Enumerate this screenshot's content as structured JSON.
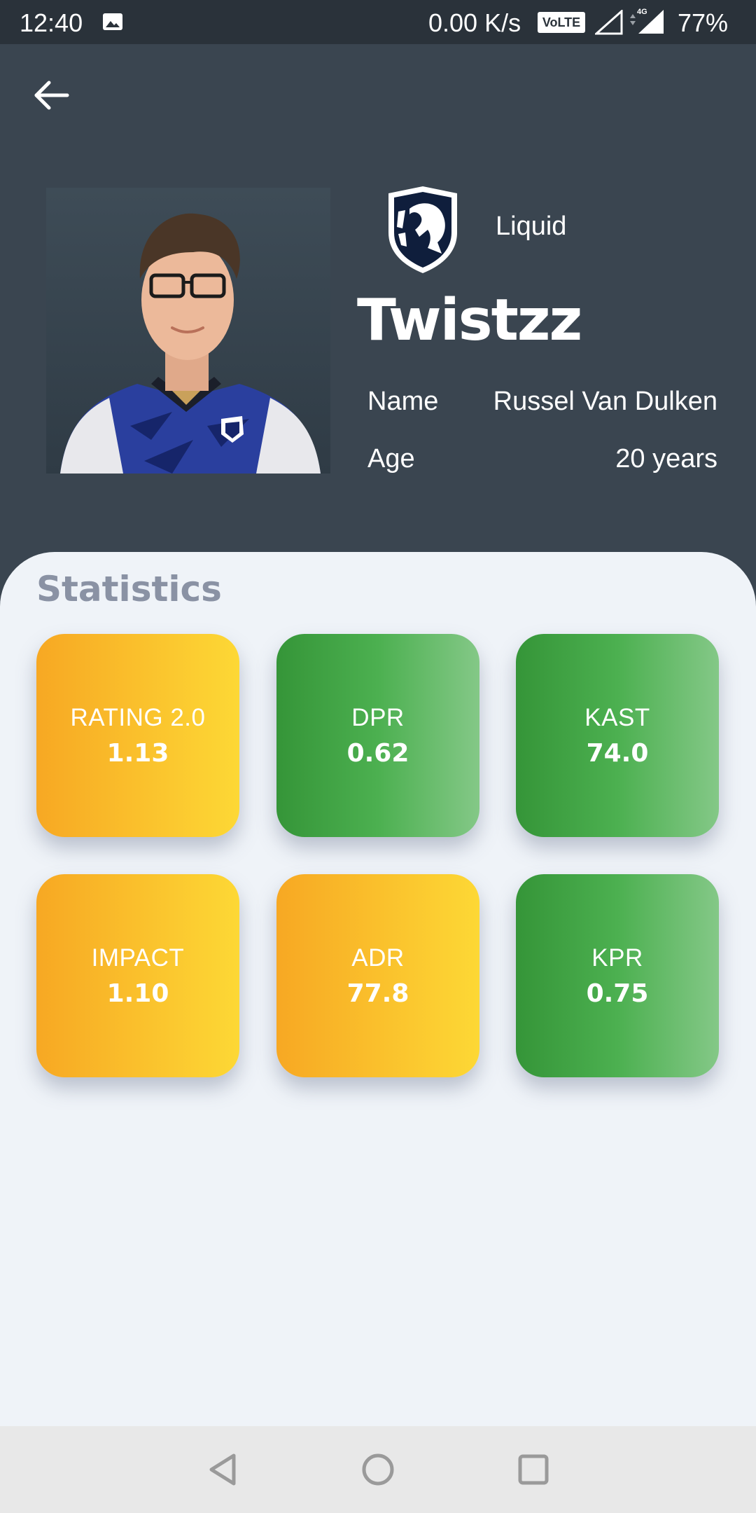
{
  "status_bar": {
    "time": "12:40",
    "network_speed": "0.00 K/s",
    "volte_badge": "VoLTE",
    "network_type": "4G",
    "battery": "77%"
  },
  "header": {
    "back_icon": "arrow-left-icon"
  },
  "player": {
    "photo_icon": "player-portrait",
    "team_logo_icon": "team-liquid-logo",
    "team": "Liquid",
    "nickname": "Twistzz",
    "name_label": "Name",
    "name_value": "Russel Van Dulken",
    "age_label": "Age",
    "age_value": "20 years"
  },
  "statistics": {
    "title": "Statistics",
    "cards": [
      {
        "label": "RATING 2.0",
        "value": "1.13",
        "color": "yellow"
      },
      {
        "label": "DPR",
        "value": "0.62",
        "color": "green"
      },
      {
        "label": "KAST",
        "value": "74.0",
        "color": "green"
      },
      {
        "label": "IMPACT",
        "value": "1.10",
        "color": "yellow"
      },
      {
        "label": "ADR",
        "value": "77.8",
        "color": "yellow"
      },
      {
        "label": "KPR",
        "value": "0.75",
        "color": "green"
      }
    ]
  },
  "colors": {
    "header_bg": "#3a4550",
    "status_bar_bg": "#2a323a",
    "panel_bg": "#eff3f8",
    "yellow_start": "#f7a823",
    "yellow_end": "#fdd835",
    "green_start": "#359538",
    "green_end": "#84c887",
    "stats_title": "#8a92a4"
  },
  "nav_bar": {
    "back": "nav-back-icon",
    "home": "nav-home-icon",
    "recents": "nav-recents-icon"
  }
}
